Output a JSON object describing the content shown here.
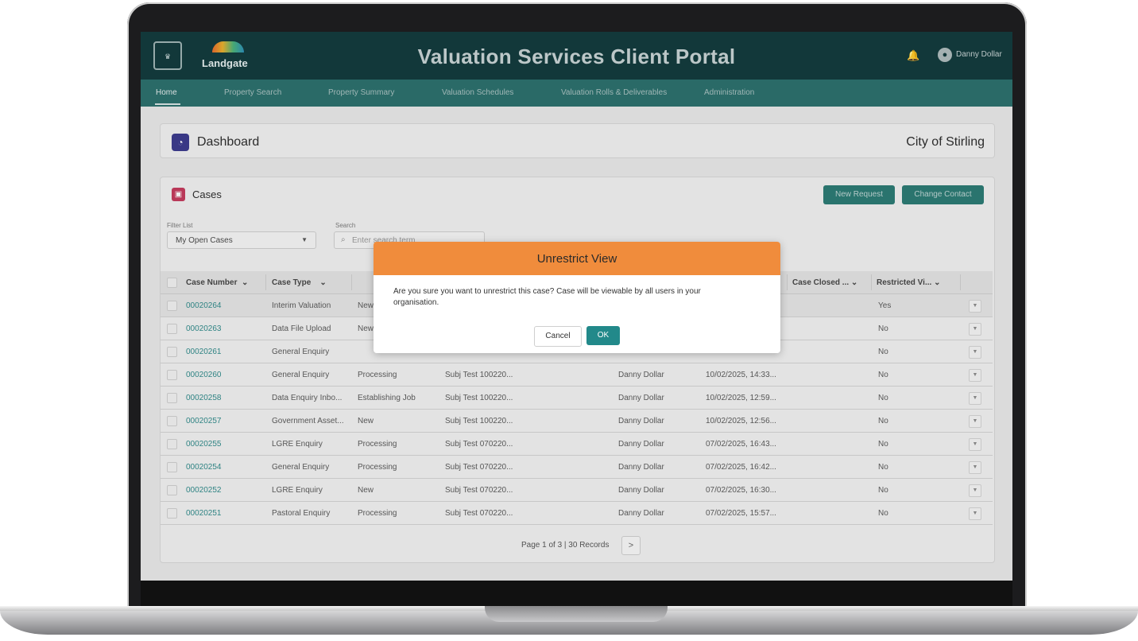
{
  "header": {
    "logo_text": "Landgate",
    "portal_title": "Valuation Services Client Portal",
    "user_name": "Danny Dollar"
  },
  "nav": {
    "items": [
      {
        "label": "Home",
        "active": true
      },
      {
        "label": "Property Search"
      },
      {
        "label": "Property Summary"
      },
      {
        "label": "Valuation Schedules"
      },
      {
        "label": "Valuation Rolls & Deliverables"
      },
      {
        "label": "Administration"
      }
    ]
  },
  "dashboard": {
    "title": "Dashboard",
    "organisation": "City of Stirling"
  },
  "cases": {
    "title": "Cases",
    "new_request_label": "New Request",
    "change_contact_label": "Change Contact",
    "filter_label": "Filter List",
    "filter_value": "My Open Cases",
    "search_label": "Search",
    "search_placeholder": "Enter search term",
    "columns": [
      "Case Number",
      "Case Type",
      "Case Closed ...",
      "Restricted Vi..."
    ],
    "rows": [
      {
        "number": "00020264",
        "type": "Interim Valuation",
        "status": "New",
        "subject": "",
        "owner": "",
        "created": "",
        "restricted": "Yes"
      },
      {
        "number": "00020263",
        "type": "Data File Upload",
        "status": "New",
        "subject": "",
        "owner": "",
        "created": "",
        "restricted": "No"
      },
      {
        "number": "00020261",
        "type": "General Enquiry",
        "status": "",
        "subject": "",
        "owner": "",
        "created": "",
        "restricted": "No"
      },
      {
        "number": "00020260",
        "type": "General Enquiry",
        "status": "Processing",
        "subject": "Subj Test 100220...",
        "owner": "Danny Dollar",
        "created": "10/02/2025, 14:33...",
        "restricted": "No"
      },
      {
        "number": "00020258",
        "type": "Data Enquiry Inbo...",
        "status": "Establishing Job",
        "subject": "Subj Test 100220...",
        "owner": "Danny Dollar",
        "created": "10/02/2025, 12:59...",
        "restricted": "No"
      },
      {
        "number": "00020257",
        "type": "Government Asset...",
        "status": "New",
        "subject": "Subj Test 100220...",
        "owner": "Danny Dollar",
        "created": "10/02/2025, 12:56...",
        "restricted": "No"
      },
      {
        "number": "00020255",
        "type": "LGRE Enquiry",
        "status": "Processing",
        "subject": "Subj Test 070220...",
        "owner": "Danny Dollar",
        "created": "07/02/2025, 16:43...",
        "restricted": "No"
      },
      {
        "number": "00020254",
        "type": "General Enquiry",
        "status": "Processing",
        "subject": "Subj Test 070220...",
        "owner": "Danny Dollar",
        "created": "07/02/2025, 16:42...",
        "restricted": "No"
      },
      {
        "number": "00020252",
        "type": "LGRE Enquiry",
        "status": "New",
        "subject": "Subj Test 070220...",
        "owner": "Danny Dollar",
        "created": "07/02/2025, 16:30...",
        "restricted": "No"
      },
      {
        "number": "00020251",
        "type": "Pastoral Enquiry",
        "status": "Processing",
        "subject": "Subj Test 070220...",
        "owner": "Danny Dollar",
        "created": "07/02/2025, 15:57...",
        "restricted": "No"
      }
    ],
    "pagination": "Page 1 of 3 | 30 Records"
  },
  "modal": {
    "title": "Unrestrict View",
    "message": "Are you sure you want to unrestrict this case? Case will be viewable by all users in your organisation.",
    "cancel_label": "Cancel",
    "ok_label": "OK"
  },
  "colors": {
    "header_bg": "#113a3c",
    "nav_bg": "#2b6f6c",
    "accent_teal": "#22898a",
    "modal_header": "#f08c3c",
    "link": "#2f8a8a"
  }
}
